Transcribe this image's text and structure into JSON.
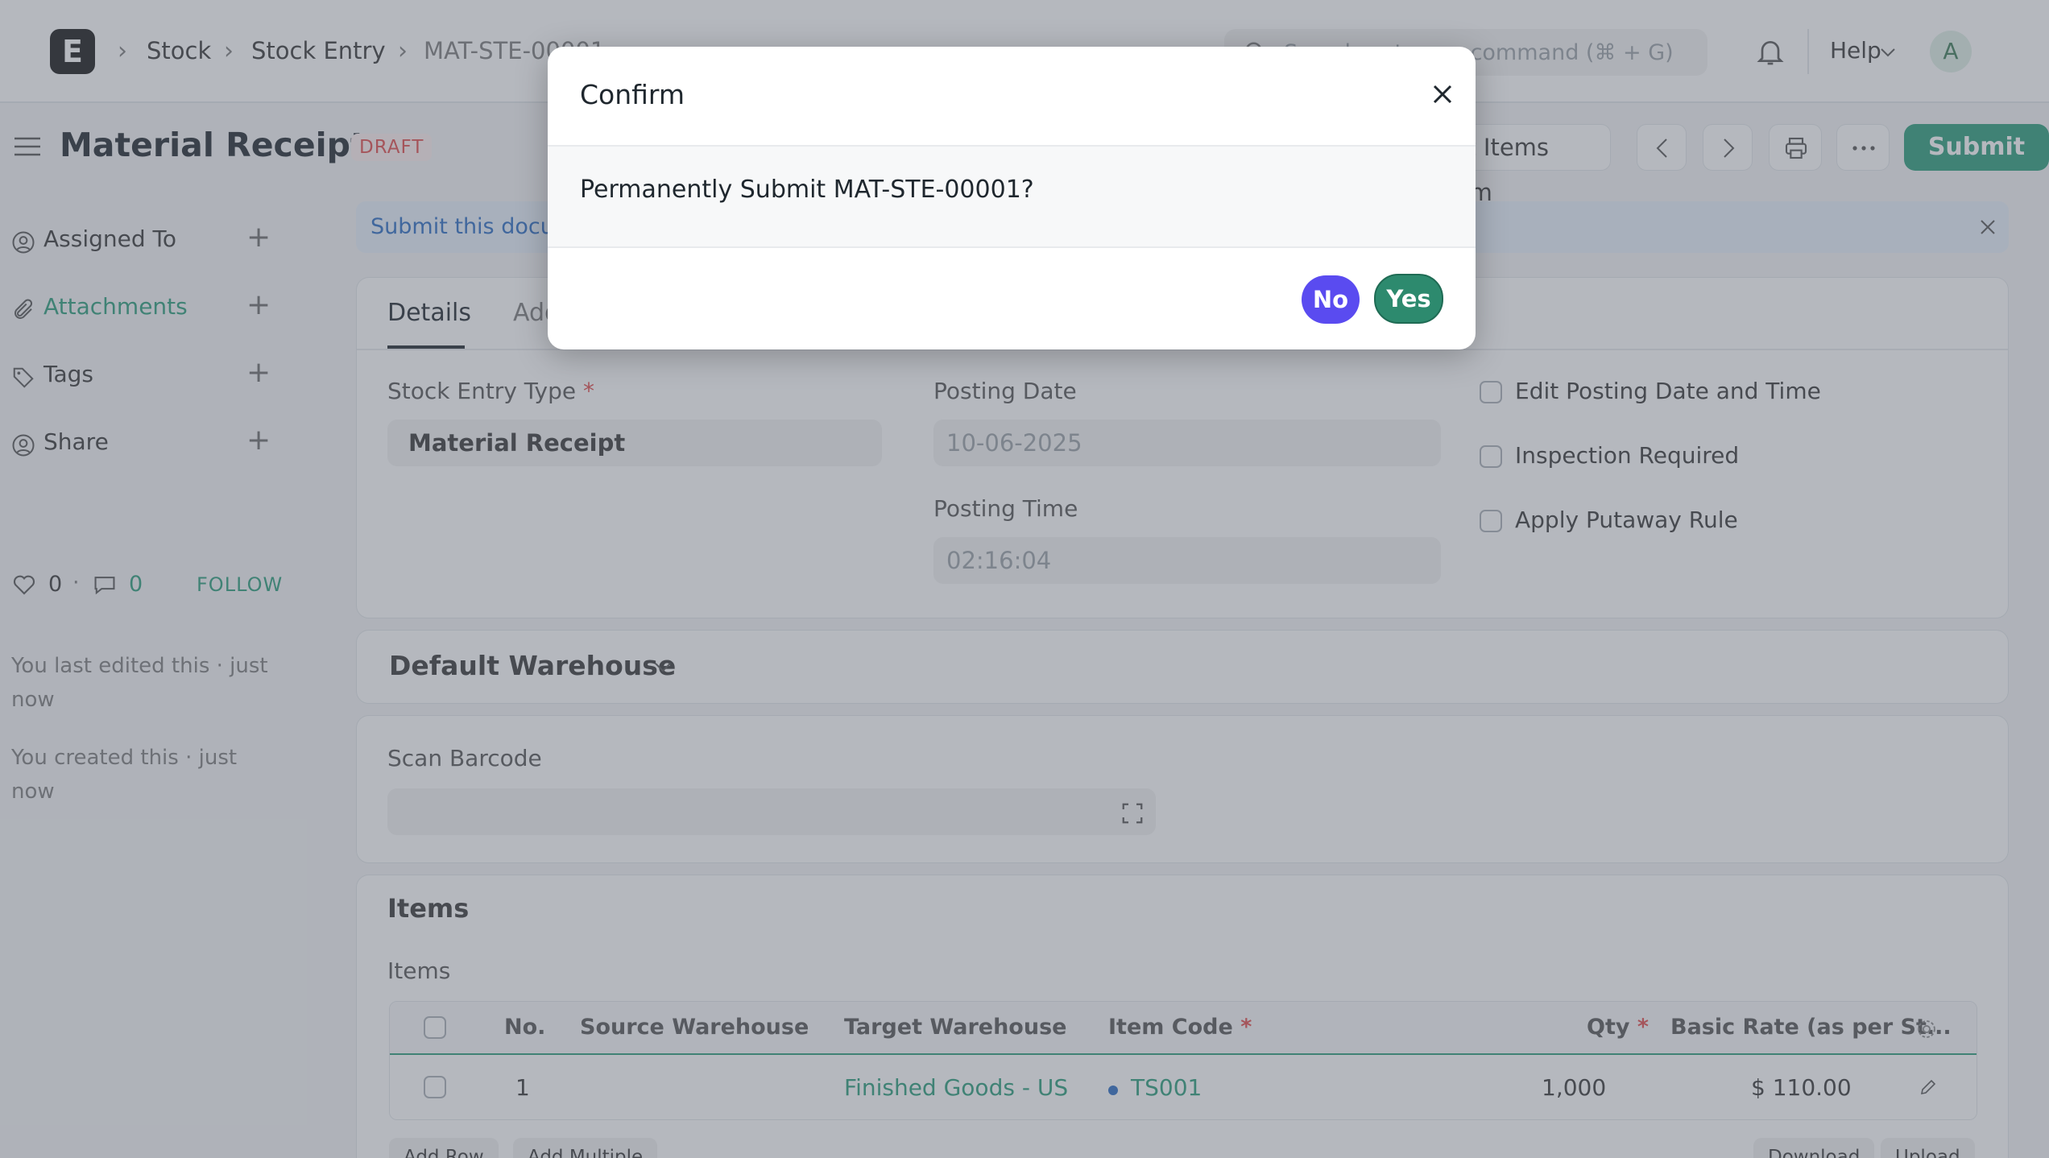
{
  "navbar": {
    "logo_letter": "E",
    "breadcrumbs": [
      "Stock",
      "Stock Entry",
      "MAT-STE-00001"
    ],
    "search_placeholder": "Search or type a command (⌘ + G)",
    "help_label": "Help",
    "avatar_letter": "A"
  },
  "page": {
    "title": "Material Receipt",
    "status": "DRAFT",
    "get_items_label": "Get Items From",
    "submit_label": "Submit"
  },
  "sidebar": {
    "items": [
      {
        "label": "Assigned To"
      },
      {
        "label": "Attachments"
      },
      {
        "label": "Tags"
      },
      {
        "label": "Share"
      }
    ],
    "likes": "0",
    "comments": "0",
    "follow_label": "FOLLOW",
    "last_edited": "You last edited this · just now",
    "created": "You created this · just now"
  },
  "alert": {
    "text": "Submit this document to confirm"
  },
  "form": {
    "tabs": [
      "Details",
      "Additional Costs"
    ],
    "stock_entry_type_label": "Stock Entry Type",
    "stock_entry_type_value": "Material Receipt",
    "posting_date_label": "Posting Date",
    "posting_date_value": "10-06-2025",
    "posting_time_label": "Posting Time",
    "posting_time_value": "02:16:04",
    "checkboxes": [
      "Edit Posting Date and Time",
      "Inspection Required",
      "Apply Putaway Rule"
    ],
    "default_warehouse_label": "Default Warehouse",
    "scan_barcode_label": "Scan Barcode",
    "items_section_title": "Items",
    "items_table_label": "Items"
  },
  "items_table": {
    "columns": [
      "No.",
      "Source Warehouse",
      "Target Warehouse",
      "Item Code",
      "Qty",
      "Basic Rate (as per St..."
    ],
    "rows": [
      {
        "no": "1",
        "source": "",
        "target": "Finished Goods - US",
        "item_code": "TS001",
        "qty": "1,000",
        "rate": "$ 110.00"
      }
    ],
    "buttons": {
      "add_row": "Add Row",
      "add_multiple": "Add Multiple",
      "download": "Download",
      "upload": "Upload"
    }
  },
  "modal": {
    "title": "Confirm",
    "message": "Permanently Submit MAT-STE-00001?",
    "no_label": "No",
    "yes_label": "Yes"
  },
  "colors": {
    "primary_green": "#2a9d7a",
    "no_button": "#5a4bf0",
    "yes_button": "#2d8a6e",
    "draft_red": "#e24c4c"
  }
}
